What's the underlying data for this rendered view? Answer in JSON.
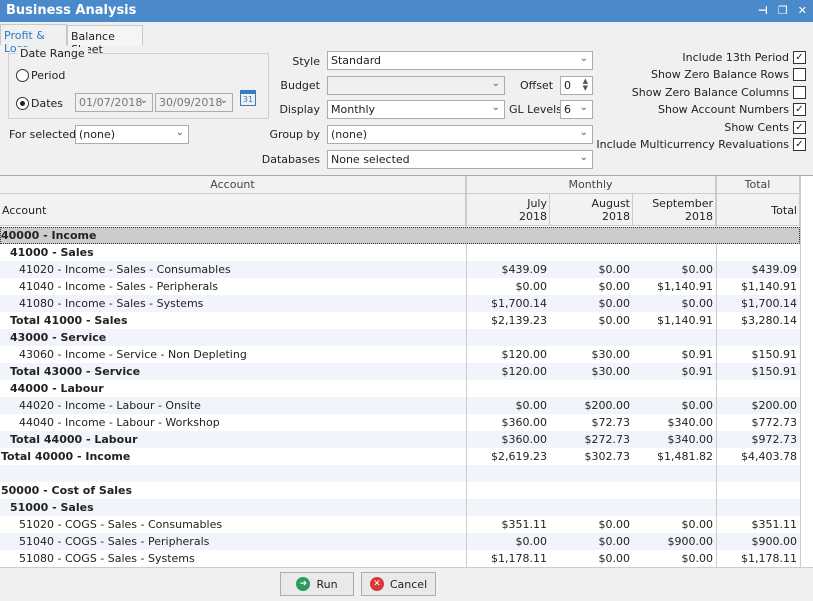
{
  "window": {
    "title": "Business Analysis"
  },
  "tabs": [
    {
      "label": "Profit & Loss",
      "active": true
    },
    {
      "label": "Balance Sheet",
      "active": false
    }
  ],
  "date_range": {
    "title": "Date Range",
    "period_label": "Period",
    "dates_label": "Dates",
    "selected": "Dates",
    "from": "01/07/2018",
    "to": "30/09/2018",
    "calendar_day": "31"
  },
  "for_selected": {
    "label": "For selected",
    "value": "(none)"
  },
  "style": {
    "label": "Style",
    "value": "Standard"
  },
  "budget": {
    "label": "Budget",
    "value": ""
  },
  "offset": {
    "label": "Offset",
    "value": "0"
  },
  "display": {
    "label": "Display",
    "value": "Monthly"
  },
  "gl_levels": {
    "label": "GL Levels",
    "value": "6"
  },
  "group_by": {
    "label": "Group by",
    "value": "(none)"
  },
  "databases": {
    "label": "Databases",
    "value": "None selected"
  },
  "options": [
    {
      "label": "Include 13th Period",
      "checked": true
    },
    {
      "label": "Show Zero Balance Rows",
      "checked": false
    },
    {
      "label": "Show Zero Balance Columns",
      "checked": false
    },
    {
      "label": "Show Account Numbers",
      "checked": true
    },
    {
      "label": "Show Cents",
      "checked": true
    },
    {
      "label": "Include Multicurrency Revaluations",
      "checked": true
    }
  ],
  "grid": {
    "band_account": "Account",
    "band_monthly": "Monthly",
    "band_total": "Total",
    "col_account": "Account",
    "col_july": "July\n2018",
    "col_august": "August\n2018",
    "col_september": "September\n2018",
    "col_total": "Total",
    "rows": [
      {
        "account": "40000 - Income",
        "level": 0,
        "bold": true,
        "values": [
          "",
          "",
          "",
          ""
        ]
      },
      {
        "account": "41000 - Sales",
        "level": 1,
        "bold": true,
        "values": [
          "",
          "",
          "",
          ""
        ]
      },
      {
        "account": "41020 - Income - Sales - Consumables",
        "level": 2,
        "bold": false,
        "values": [
          "$439.09",
          "$0.00",
          "$0.00",
          "$439.09"
        ]
      },
      {
        "account": "41040 - Income - Sales - Peripherals",
        "level": 2,
        "bold": false,
        "values": [
          "$0.00",
          "$0.00",
          "$1,140.91",
          "$1,140.91"
        ]
      },
      {
        "account": "41080 - Income - Sales - Systems",
        "level": 2,
        "bold": false,
        "values": [
          "$1,700.14",
          "$0.00",
          "$0.00",
          "$1,700.14"
        ]
      },
      {
        "account": "Total 41000 - Sales",
        "level": 1,
        "bold": true,
        "values": [
          "$2,139.23",
          "$0.00",
          "$1,140.91",
          "$3,280.14"
        ]
      },
      {
        "account": "43000 - Service",
        "level": 1,
        "bold": true,
        "values": [
          "",
          "",
          "",
          ""
        ]
      },
      {
        "account": "43060 - Income - Service - Non Depleting",
        "level": 2,
        "bold": false,
        "values": [
          "$120.00",
          "$30.00",
          "$0.91",
          "$150.91"
        ]
      },
      {
        "account": "Total 43000 - Service",
        "level": 1,
        "bold": true,
        "values": [
          "$120.00",
          "$30.00",
          "$0.91",
          "$150.91"
        ]
      },
      {
        "account": "44000 - Labour",
        "level": 1,
        "bold": true,
        "values": [
          "",
          "",
          "",
          ""
        ]
      },
      {
        "account": "44020 - Income - Labour - Onsite",
        "level": 2,
        "bold": false,
        "values": [
          "$0.00",
          "$200.00",
          "$0.00",
          "$200.00"
        ]
      },
      {
        "account": "44040 - Income - Labour - Workshop",
        "level": 2,
        "bold": false,
        "values": [
          "$360.00",
          "$72.73",
          "$340.00",
          "$772.73"
        ]
      },
      {
        "account": "Total 44000 - Labour",
        "level": 1,
        "bold": true,
        "values": [
          "$360.00",
          "$272.73",
          "$340.00",
          "$972.73"
        ]
      },
      {
        "account": "Total 40000 - Income",
        "level": 0,
        "bold": true,
        "values": [
          "$2,619.23",
          "$302.73",
          "$1,481.82",
          "$4,403.78"
        ]
      },
      {
        "account": "",
        "level": 0,
        "bold": false,
        "values": [
          "",
          "",
          "",
          ""
        ]
      },
      {
        "account": "50000 - Cost of Sales",
        "level": 0,
        "bold": true,
        "values": [
          "",
          "",
          "",
          ""
        ]
      },
      {
        "account": "51000 - Sales",
        "level": 1,
        "bold": true,
        "values": [
          "",
          "",
          "",
          ""
        ]
      },
      {
        "account": "51020 - COGS - Sales - Consumables",
        "level": 2,
        "bold": false,
        "values": [
          "$351.11",
          "$0.00",
          "$0.00",
          "$351.11"
        ]
      },
      {
        "account": "51040 - COGS - Sales - Peripherals",
        "level": 2,
        "bold": false,
        "values": [
          "$0.00",
          "$0.00",
          "$900.00",
          "$900.00"
        ]
      },
      {
        "account": "51080 - COGS - Sales - Systems",
        "level": 2,
        "bold": false,
        "values": [
          "$1,178.11",
          "$0.00",
          "$0.00",
          "$1,178.11"
        ]
      }
    ]
  },
  "buttons": {
    "run": "Run",
    "cancel": "Cancel"
  },
  "colors": {
    "title_bar": "#4a8acb",
    "selected_row": "#cccccc",
    "alt_row": "#f1f5fb",
    "run_icon": "#2a9d5c",
    "cancel_icon": "#d9383a"
  }
}
